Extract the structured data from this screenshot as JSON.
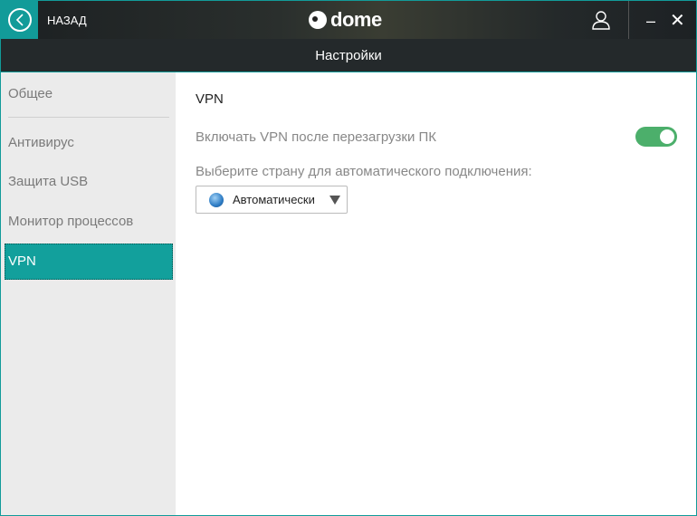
{
  "header": {
    "back_label": "НАЗАД",
    "logo_text": "dome",
    "title": "Настройки"
  },
  "sidebar": {
    "items": [
      {
        "label": "Общее"
      },
      {
        "label": "Антивирус"
      },
      {
        "label": "Защита USB"
      },
      {
        "label": "Монитор процессов"
      },
      {
        "label": "VPN",
        "selected": true
      }
    ]
  },
  "vpn": {
    "heading": "VPN",
    "autostart_label": "Включать VPN после перезагрузки ПК",
    "autostart_enabled": true,
    "country_label": "Выберите страну для автоматического подключения:",
    "country_value": "Автоматически"
  },
  "colors": {
    "accent": "#129b99",
    "toggle_on": "#4caf6b"
  }
}
